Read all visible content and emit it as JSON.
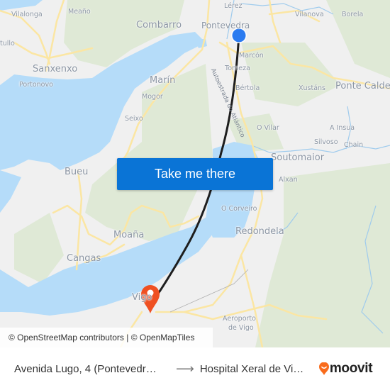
{
  "map": {
    "colors": {
      "land": "#f0f0f0",
      "water": "#b5dcf9",
      "park": "#dfe9d6",
      "road": "#fbe6a3",
      "route": "#1e1e1e",
      "origin_marker": "#2b7bf0",
      "destination_marker": "#ef5022"
    },
    "places": [
      {
        "name": "Lérez",
        "size": "small"
      },
      {
        "name": "Vilalonga",
        "size": "small"
      },
      {
        "name": "Meaño",
        "size": "small"
      },
      {
        "name": "Combarro",
        "size": "big"
      },
      {
        "name": "Pontevedra",
        "size": "mid"
      },
      {
        "name": "Vilanova",
        "size": "small"
      },
      {
        "name": "Borela",
        "size": "small"
      },
      {
        "name": "tullo",
        "size": "small"
      },
      {
        "name": "Sanxenxo",
        "size": "big"
      },
      {
        "name": "Marcón",
        "size": "small"
      },
      {
        "name": "Tomeza",
        "size": "small"
      },
      {
        "name": "Marín",
        "size": "big"
      },
      {
        "name": "Portonovo",
        "size": "small"
      },
      {
        "name": "Bértola",
        "size": "small"
      },
      {
        "name": "Xustáns",
        "size": "small"
      },
      {
        "name": "Ponte Calde",
        "size": "big"
      },
      {
        "name": "Mogor",
        "size": "small"
      },
      {
        "name": "Seixo",
        "size": "small"
      },
      {
        "name": "O Vilar",
        "size": "small"
      },
      {
        "name": "A Insua",
        "size": "small"
      },
      {
        "name": "Silvoso",
        "size": "small"
      },
      {
        "name": "Chain",
        "size": "small"
      },
      {
        "name": "Soutomaior",
        "size": "big"
      },
      {
        "name": "Bueu",
        "size": "big"
      },
      {
        "name": "Alxan",
        "size": "small"
      },
      {
        "name": "O Corveiro",
        "size": "small"
      },
      {
        "name": "Moaña",
        "size": "big"
      },
      {
        "name": "Redondela",
        "size": "big"
      },
      {
        "name": "Cangas",
        "size": "big"
      },
      {
        "name": "Vigo",
        "size": "big"
      },
      {
        "name": "Aeroporto",
        "size": "small"
      },
      {
        "name": "de Vigo",
        "size": "small"
      }
    ],
    "road_label": "Autoestrada do Atlántico",
    "origin_marker_icon": "origin-dot-icon",
    "destination_marker_icon": "destination-pin-icon"
  },
  "cta": {
    "label": "Take me there"
  },
  "attribution": "© OpenStreetMap contributors | © OpenMapTiles",
  "footer": {
    "origin": "Avenida Lugo, 4 (Pontevedr…",
    "arrow_icon": "arrow-right-icon",
    "arrow": "⟶",
    "destination": "Hospital Xeral de Vi…",
    "brand": "moovit",
    "brand_icon": "moovit-pin-icon",
    "brand_color": "#f96b1b"
  }
}
